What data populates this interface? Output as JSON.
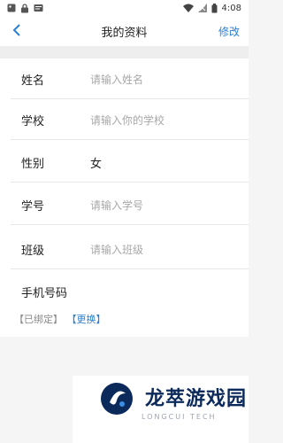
{
  "status_bar": {
    "time": "4:08"
  },
  "nav": {
    "back_icon": "chevron-left-icon",
    "title": "我的资料",
    "edit_label": "修改",
    "accent": "#2a7fd6"
  },
  "form": {
    "rows": [
      {
        "label": "姓名",
        "value": "",
        "placeholder": "请输入姓名"
      },
      {
        "label": "学校",
        "value": "",
        "placeholder": "请输入你的学校"
      },
      {
        "label": "性别",
        "value": "女",
        "placeholder": ""
      },
      {
        "label": "学号",
        "value": "",
        "placeholder": "请输入学号"
      },
      {
        "label": "班级",
        "value": "",
        "placeholder": "请输入班级"
      },
      {
        "label": "手机号码",
        "value": "",
        "placeholder": ""
      }
    ],
    "phone_bound_text": "【已绑定】",
    "phone_change_text": "【更换】"
  },
  "watermark": {
    "name": "龙萃游戏园",
    "sub": "LONGCUI TECH"
  }
}
